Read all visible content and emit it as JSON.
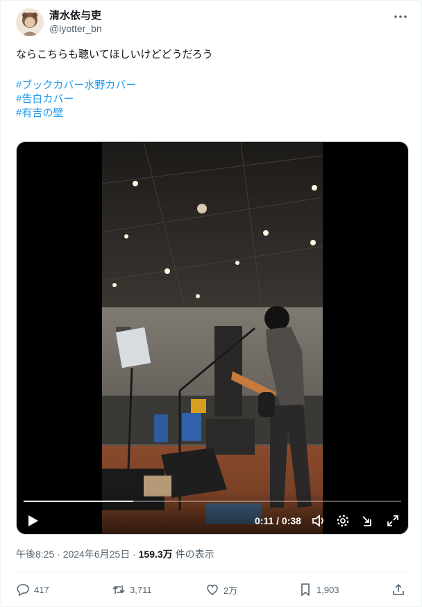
{
  "author": {
    "display_name": "清水依与吏",
    "handle": "@iyotter_bn"
  },
  "tweet": {
    "text": "ならこちらも聴いてほしいけどどうだろう",
    "hashtags": [
      "#ブックカバー水野カバー",
      "#告白カバー",
      "#有吉の壁"
    ]
  },
  "video": {
    "current_time": "0:11",
    "duration": "0:38",
    "time_display": "0:11 / 0:38",
    "progress_fraction": 0.29
  },
  "meta": {
    "timestamp": "午後8:25 · 2024年6月25日 · ",
    "views_count": "159.3万",
    "views_suffix": " 件の表示"
  },
  "actions": {
    "replies": "417",
    "reposts": "3,711",
    "likes": "2万",
    "bookmarks": "1,903"
  },
  "colors": {
    "hashtag": "#1d9bf0",
    "secondary_text": "#536471",
    "primary_text": "#0f1419"
  },
  "icons": {
    "more": "more-dots-icon",
    "play": "play-icon",
    "volume": "volume-icon",
    "settings": "gear-icon",
    "pip": "picture-in-picture-icon",
    "fullscreen": "fullscreen-icon",
    "reply": "reply-icon",
    "repost": "repost-icon",
    "like": "heart-icon",
    "bookmark": "bookmark-icon",
    "share": "share-icon"
  }
}
